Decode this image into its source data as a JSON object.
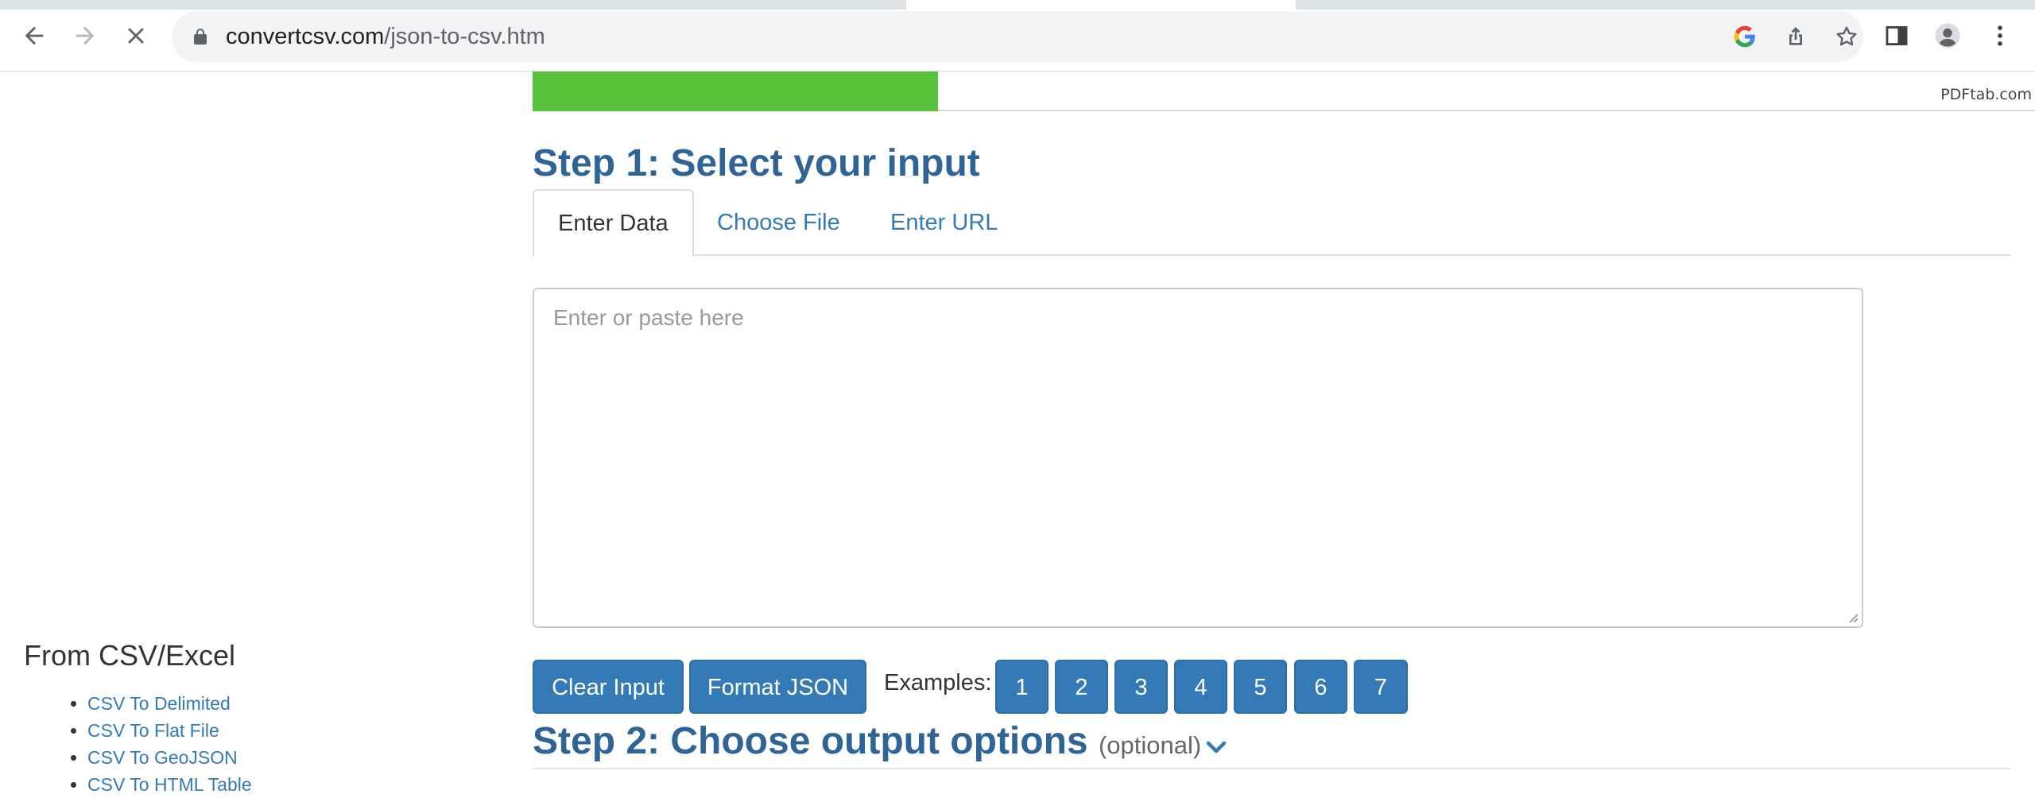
{
  "browser": {
    "url_host": "convertcsv.com",
    "url_path": "/json-to-csv.htm"
  },
  "progress": {
    "fraction": 0.27,
    "ad_label": "PDFtab.com",
    "fill_color": "#57c13c"
  },
  "step1": {
    "title": "Step 1: Select your input",
    "tabs": [
      {
        "label": "Enter Data",
        "active": true
      },
      {
        "label": "Choose File",
        "active": false
      },
      {
        "label": "Enter URL",
        "active": false
      }
    ],
    "input_placeholder": "Enter or paste here",
    "buttons": {
      "clear": "Clear Input",
      "format": "Format JSON"
    },
    "examples_label": "Examples:",
    "examples": [
      "1",
      "2",
      "3",
      "4",
      "5",
      "6",
      "7"
    ]
  },
  "step2": {
    "title": "Step 2: Choose output options",
    "optional": "(optional)"
  },
  "sidebar": {
    "heading": "From CSV/Excel",
    "links": [
      "CSV To Delimited",
      "CSV To Flat File",
      "CSV To GeoJSON",
      "CSV To HTML Table"
    ]
  },
  "colors": {
    "accent": "#337ab7",
    "heading": "#2f6496"
  },
  "icons": [
    "back-arrow-icon",
    "forward-arrow-icon",
    "stop-loading-icon",
    "lock-icon",
    "google-icon",
    "share-icon",
    "star-icon",
    "side-panel-icon",
    "profile-icon",
    "menu-kebab-icon",
    "chevron-down-icon"
  ]
}
